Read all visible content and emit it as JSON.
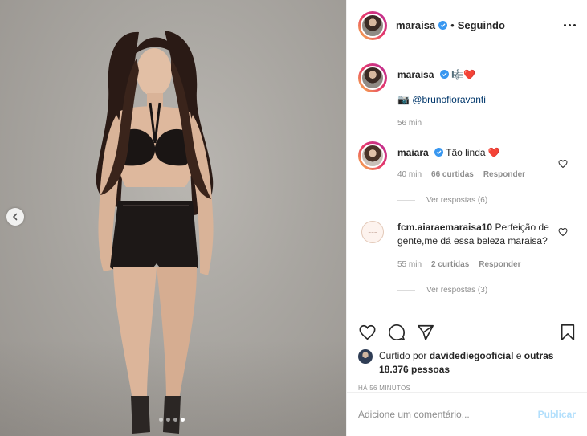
{
  "post": {
    "image_alt": "Woman posing in black outfit",
    "carousel": {
      "dots": 4,
      "active_index": 3
    }
  },
  "header": {
    "username": "maraisa",
    "separator": "•",
    "follow_status": "Seguindo"
  },
  "caption": {
    "username": "maraisa",
    "emojis": "🎼❤️",
    "camera_emoji": "📷",
    "mention": "@brunofioravanti",
    "time": "56 min"
  },
  "comments": [
    {
      "username": "maiara",
      "text": "Tão linda",
      "emoji": "❤️",
      "time": "40 min",
      "likes": "66 curtidas",
      "reply_label": "Responder",
      "view_replies": "Ver respostas (6)"
    },
    {
      "username": "fcm.aiaraemaraisa10",
      "text": "Perfeição de gente,me dá essa beleza maraisa?",
      "time": "55 min",
      "likes": "2 curtidas",
      "reply_label": "Responder",
      "view_replies": "Ver respostas (3)"
    }
  ],
  "likes": {
    "prefix": "Curtido por",
    "user": "davidediegooficial",
    "conjunction": "e",
    "others": "outras 18.376 pessoas"
  },
  "timestamp": "HÁ 56 MINUTOS",
  "add_comment": {
    "placeholder": "Adicione um comentário...",
    "publish_label": "Publicar"
  },
  "colors": {
    "verified": "#3897f0",
    "heart": "#ed4956",
    "publish_disabled": "#b2dffc"
  }
}
